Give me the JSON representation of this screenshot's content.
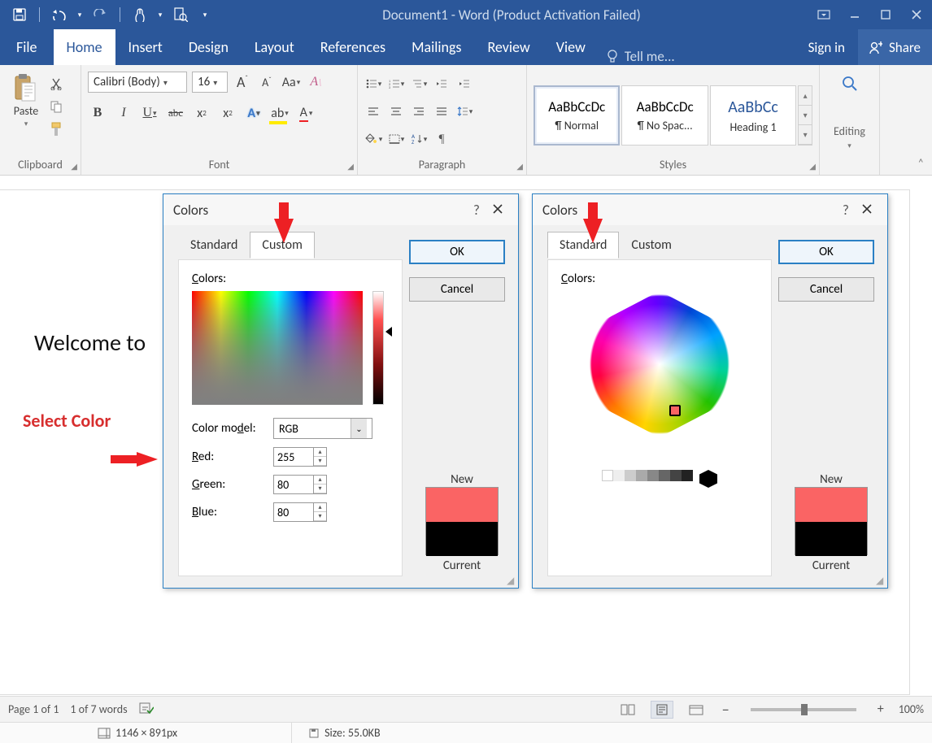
{
  "title": "Document1 - Word (Product Activation Failed)",
  "tabs": {
    "file": "File",
    "home": "Home",
    "insert": "Insert",
    "design": "Design",
    "layout": "Layout",
    "references": "References",
    "mailings": "Mailings",
    "review": "Review",
    "view": "View",
    "tell": "Tell me..."
  },
  "account": {
    "signin": "Sign in",
    "share": "Share"
  },
  "ribbon": {
    "clipboard": {
      "label": "Clipboard",
      "paste": "Paste"
    },
    "font": {
      "label": "Font",
      "name": "Calibri (Body)",
      "size": "16",
      "bold": "B",
      "italic": "I",
      "underline": "U",
      "strike": "abc",
      "sub": "x",
      "sup": "x",
      "effects": "A",
      "highlight": "A",
      "color": "A",
      "grow": "A",
      "shrink": "A",
      "case": "Aa",
      "clear": "A"
    },
    "paragraph": {
      "label": "Paragraph"
    },
    "styles": {
      "label": "Styles",
      "items": [
        {
          "preview": "AaBbCcDc",
          "name": "¶ Normal",
          "color": "#333"
        },
        {
          "preview": "AaBbCcDc",
          "name": "¶ No Spac...",
          "color": "#333"
        },
        {
          "preview": "AaBbCc",
          "name": "Heading 1",
          "color": "#2b579a"
        }
      ]
    },
    "editing": {
      "label": "Editing"
    }
  },
  "document": {
    "text": "Welcome to"
  },
  "annotation": {
    "label": "Select Color"
  },
  "dlg": {
    "title": "Colors",
    "ok": "OK",
    "cancel": "Cancel",
    "standard": "Standard",
    "custom": "Custom",
    "colors_lbl": "Colors:",
    "model_lbl": "Color model:",
    "model": "RGB",
    "red_lbl": "Red:",
    "green_lbl": "Green:",
    "blue_lbl": "Blue:",
    "red": "255",
    "green": "80",
    "blue": "80",
    "new": "New",
    "current": "Current",
    "help": "?",
    "close": "×"
  },
  "status": {
    "page": "Page 1 of 1",
    "words": "1 of 7 words",
    "zoom": "100%",
    "minus": "−",
    "plus": "+"
  },
  "viewer": {
    "dims": "1146 × 891px",
    "size": "Size: 55.0KB"
  }
}
